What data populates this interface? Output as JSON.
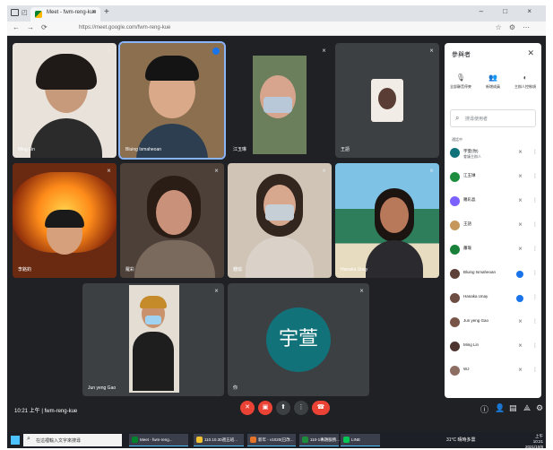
{
  "browser": {
    "tab_title": "Meet - fwm-reng-kue",
    "url": "https://meet.google.com/fwm-reng-kue",
    "new_tab": "+",
    "close_tab": "×",
    "window_controls": "– □ ×"
  },
  "tiles": [
    {
      "name": "Ming Lin"
    },
    {
      "name": "Bluing Ismaheoan"
    },
    {
      "name": "江玉琳"
    },
    {
      "name": "王語"
    },
    {
      "name": "李銘鈞"
    },
    {
      "name": "羅彩"
    },
    {
      "name": "鍾瑜"
    },
    {
      "name": "Hanaka Unay"
    },
    {
      "name": "Jun yeng Gao"
    },
    {
      "name": "你"
    }
  ],
  "avatar_initials": "宇萱",
  "meeting": {
    "time_code": "10:21 上午 | fwm-reng-kue"
  },
  "panel": {
    "title": "參與者",
    "actions": [
      {
        "label": "全部靜音停麥",
        "icon": "mic-off-icon"
      },
      {
        "label": "新增成員",
        "icon": "add-person-icon"
      },
      {
        "label": "主辦人控制項",
        "icon": "toggle-icon"
      }
    ],
    "search_placeholder": "搜尋使用者",
    "section": "通話中",
    "participants": [
      {
        "name": "宇萱(你)",
        "sub": "會議主辦人",
        "color": "#12727a",
        "state": "mute"
      },
      {
        "name": "江玉琳",
        "sub": "",
        "color": "#1e8e3e",
        "state": "mute"
      },
      {
        "name": "羅彩晶",
        "sub": "",
        "color": "#7b61ff",
        "state": "mute"
      },
      {
        "name": "王語",
        "sub": "",
        "color": "#c5975a",
        "state": "mute"
      },
      {
        "name": "蕭瑜",
        "sub": "",
        "color": "#188038",
        "state": "mute"
      },
      {
        "name": "Bluing Ismaheoan",
        "sub": "",
        "color": "#5d4037",
        "state": "active"
      },
      {
        "name": "Hanaka Unay",
        "sub": "",
        "color": "#6d4c41",
        "state": "active"
      },
      {
        "name": "Jun yeng Gao",
        "sub": "",
        "color": "#795548",
        "state": "mute"
      },
      {
        "name": "Ming Lin",
        "sub": "",
        "color": "#4e342e",
        "state": "mute"
      },
      {
        "name": "WJ",
        "sub": "",
        "color": "#8d6e63",
        "state": "mute"
      }
    ]
  },
  "taskbar": {
    "search_placeholder": "在這裡輸入文字來搜尋",
    "apps": [
      {
        "label": "Meet - fwm-reng...",
        "color": "#00832d"
      },
      {
        "label": "110.10.30週五班...",
        "color": "#f1c232"
      },
      {
        "label": "新年 - v1020(已改...",
        "color": "#e6732a"
      },
      {
        "label": "110-1專題服務...",
        "color": "#1e8e3e"
      },
      {
        "label": "LINE",
        "color": "#06c755"
      }
    ],
    "weather": "31°C 晴時多雲",
    "time": "上午 10:21",
    "date": "2021/10/8"
  }
}
